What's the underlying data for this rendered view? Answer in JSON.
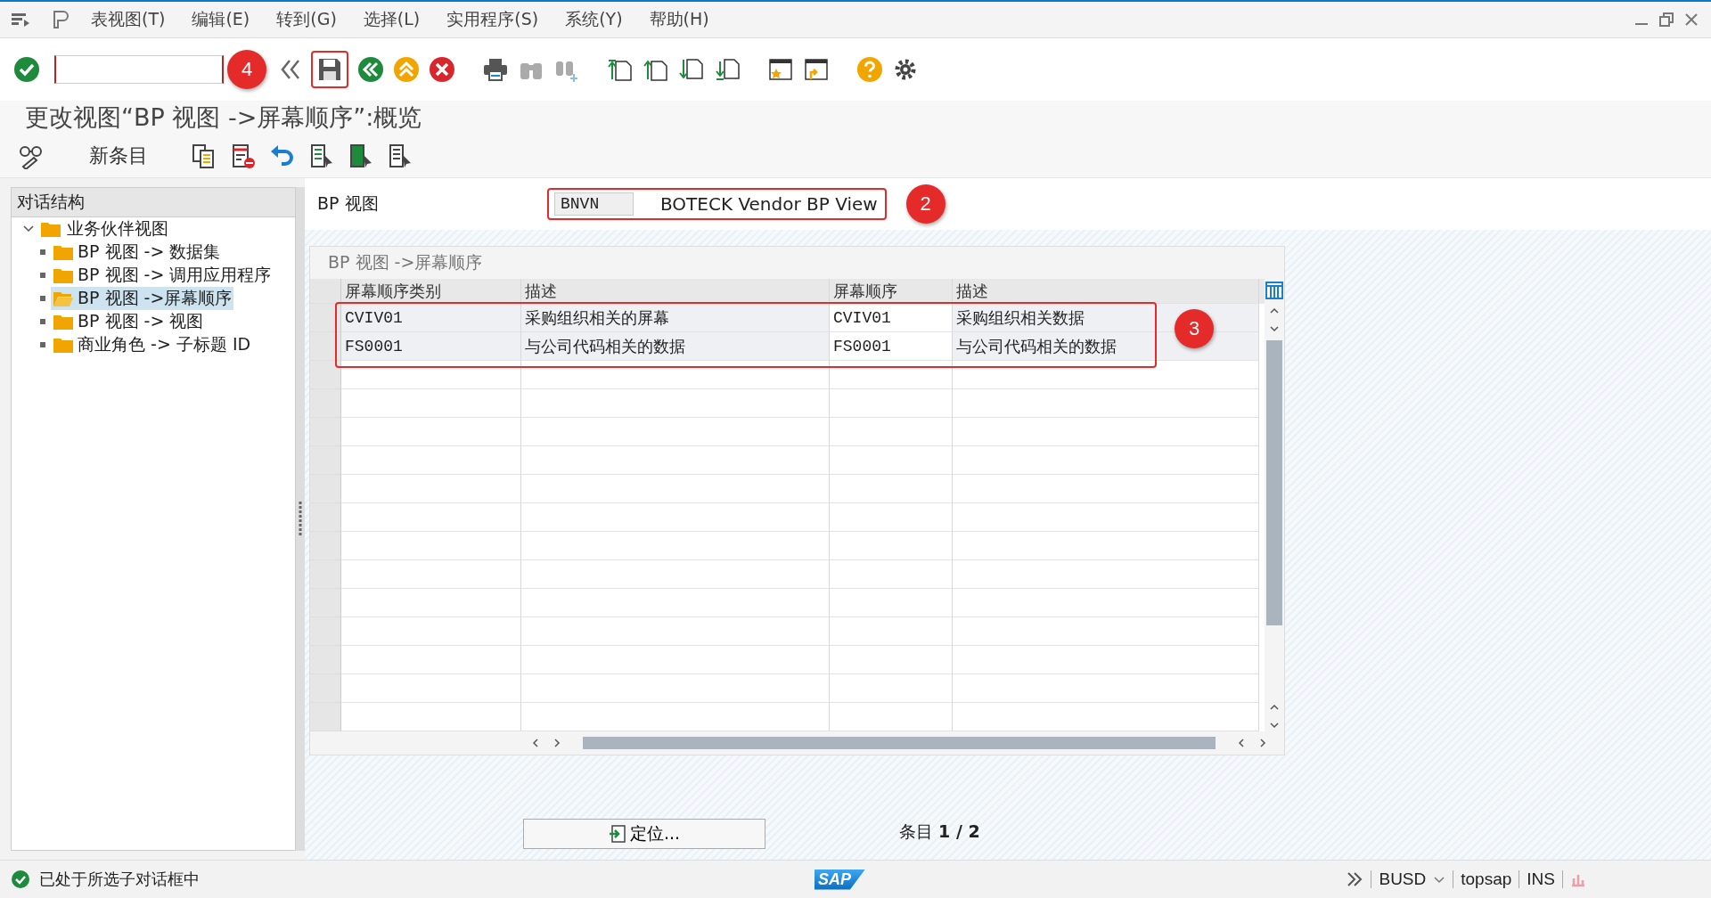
{
  "menu": [
    "表视图(T)",
    "编辑(E)",
    "转到(G)",
    "选择(L)",
    "实用程序(S)",
    "系统(Y)",
    "帮助(H)"
  ],
  "toolbar": {
    "annotation": "4"
  },
  "title": "更改视图“BP 视图 ->屏幕顺序”:概览",
  "app_toolbar": {
    "new_entries": "新条目"
  },
  "tree": {
    "title": "对话结构",
    "items": [
      {
        "label": "业务伙伴视图",
        "expanded": true,
        "selected": false,
        "children": [
          {
            "label": "BP 视图 -> 数据集",
            "selected": false
          },
          {
            "label": "BP 视图 -> 调用应用程序",
            "selected": false
          },
          {
            "label": "BP 视图 ->屏幕顺序",
            "selected": true
          },
          {
            "label": "BP 视图 -> 视图",
            "selected": false
          },
          {
            "label": "商业角色 -> 子标题 ID",
            "selected": false
          }
        ]
      }
    ]
  },
  "bp_view": {
    "label": "BP 视图",
    "code": "BNVN",
    "description": "BOTECK Vendor BP View",
    "annotation": "2"
  },
  "table": {
    "title": "BP 视图 ->屏幕顺序",
    "columns": [
      "屏幕顺序类别",
      "描述",
      "屏幕顺序",
      "描述"
    ],
    "annotation": "3",
    "rows": [
      [
        "CVIV01",
        "采购组织相关的屏幕",
        "CVIV01",
        "采购组织相关数据"
      ],
      [
        "FS0001",
        "与公司代码相关的数据",
        "FS0001",
        "与公司代码相关的数据"
      ]
    ]
  },
  "position_button": "定位...",
  "entry_count": "条目 **1 / 2**",
  "status_bar": {
    "message": "已处于所选子对话框中",
    "logo": "SAP",
    "items": [
      "BUSD",
      "topsap",
      "INS"
    ]
  }
}
